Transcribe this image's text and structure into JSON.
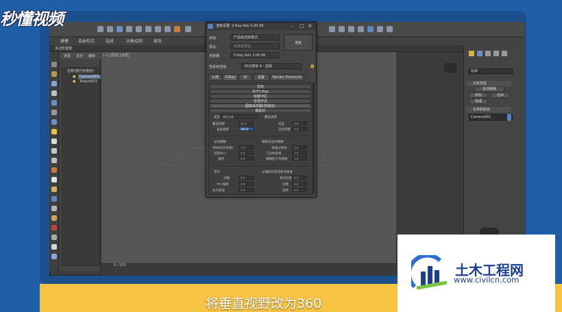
{
  "watermark": {
    "brand": "秒懂视频",
    "civil_name": "土木工程网",
    "civil_url": "www.civilcn.com"
  },
  "caption": "将垂直视野改为360",
  "menu": {
    "tabs": [
      "建模",
      "自由形式",
      "选择",
      "对象绘制",
      "填充"
    ],
    "subtab": "多边形建模"
  },
  "explorer": {
    "tabs": [
      "选择",
      "显示",
      "编辑"
    ],
    "root": "名称(按升序排序)",
    "items": [
      "Camera001",
      "Teapot001"
    ]
  },
  "viewport": {
    "label": "[+] [透视] [线框]",
    "frame_counter": "0 / 100"
  },
  "dialog": {
    "title": "渲染设置: V-Ray Adv 3.00.08",
    "target_label": "目标:",
    "target_value": "产品级渲染模式",
    "preset_label": "预设:",
    "preset_value": "未选定预设",
    "renderer_label": "渲染器:",
    "renderer_value": "V-Ray Adv 3.00.08",
    "view_label": "查看到渲染:",
    "view_value": "四元菜单 4 - 透视",
    "render_button": "渲染",
    "tabs": [
      "公用",
      "V-Ray",
      "GI",
      "设置",
      "Render Elements"
    ],
    "rollouts": [
      "授权",
      "关于V-Ray",
      "帧缓冲区",
      "全局开关",
      "图像采样器(抗锯齿)",
      "图像过滤",
      "环境",
      "颜色贴图",
      "摄影机"
    ],
    "camera_type_label": "类型",
    "camera_type_value": "球形全景",
    "override_fov": "覆盖视野",
    "vertical_fov_label": "垂直视野",
    "vertical_fov_value": "360.0",
    "fov_field_value": "45.0",
    "height_label": "高度",
    "auto_fit": "自动调整",
    "dist_label": "距离",
    "curve_label": "曲线",
    "motion_blur": "运动模糊",
    "camera_motion_blur": "摄影机运动模糊",
    "mb_duration": "持续时间(帧数)",
    "mb_center": "间隔中心",
    "mb_bias": "偏移",
    "mb_prepass": "预通过采样",
    "mb_blur_particles": "模糊粒子为网格",
    "mb_geo_samples": "几何体采样",
    "dof": "景深",
    "dof_from_camera": "从摄影机获得焦点距离",
    "dof_aperture": "光圈",
    "dof_center_bias": "中心偏移",
    "dof_focal": "焦点距离",
    "dof_anisotropy": "各向异性",
    "dof_sides": "边数",
    "dof_rotation": "旋转",
    "field_default": "0.0",
    "field_one": "1.0"
  },
  "right_panel": {
    "dropdown": "标准",
    "section_title": "对象类型",
    "buttons": [
      "目标",
      "物理",
      "自由"
    ],
    "autogrid": "自动栅格",
    "name_color_title": "名称和颜色",
    "camera_name": "Camera001"
  },
  "colors": {
    "frame_blue": "#1e5fa8",
    "caption_yellow": "#f5c242",
    "highlight_blue": "#2f5d9a"
  }
}
